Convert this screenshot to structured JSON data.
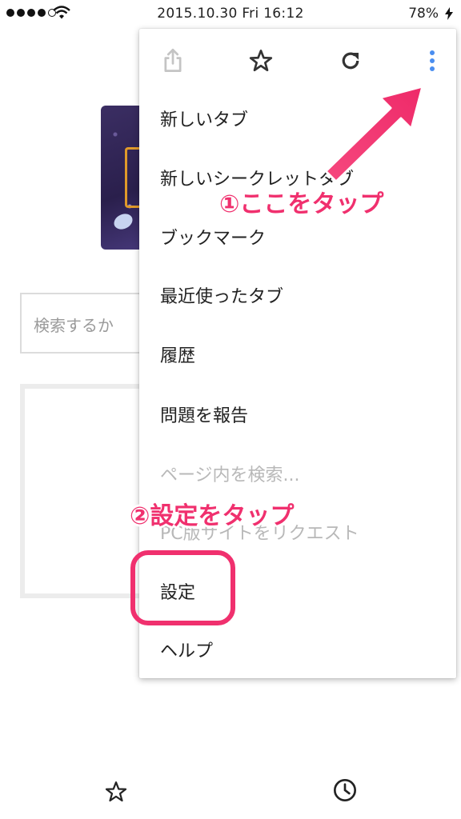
{
  "status_bar": {
    "time": "2015.10.30 Fri 16:12",
    "battery": "78%"
  },
  "page": {
    "search_placeholder": "検索するか"
  },
  "menu": {
    "toolbar_icons": [
      "share-icon",
      "star-icon",
      "reload-icon",
      "more-vert-icon"
    ],
    "items": [
      {
        "label": "新しいタブ",
        "enabled": true
      },
      {
        "label": "新しいシークレットタブ",
        "enabled": true
      },
      {
        "label": "ブックマーク",
        "enabled": true
      },
      {
        "label": "最近使ったタブ",
        "enabled": true
      },
      {
        "label": "履歴",
        "enabled": true
      },
      {
        "label": "問題を報告",
        "enabled": true
      },
      {
        "label": "ページ内を検索...",
        "enabled": false
      },
      {
        "label": "PC版サイトをリクエスト",
        "enabled": false
      },
      {
        "label": "設定",
        "enabled": true
      },
      {
        "label": "ヘルプ",
        "enabled": true
      }
    ]
  },
  "annotations": {
    "step1": "①ここをタップ",
    "step2": "②設定をタップ",
    "color": "#f0306e"
  },
  "bottom_toolbar": {
    "icons": [
      "star-icon",
      "clock-icon"
    ]
  }
}
